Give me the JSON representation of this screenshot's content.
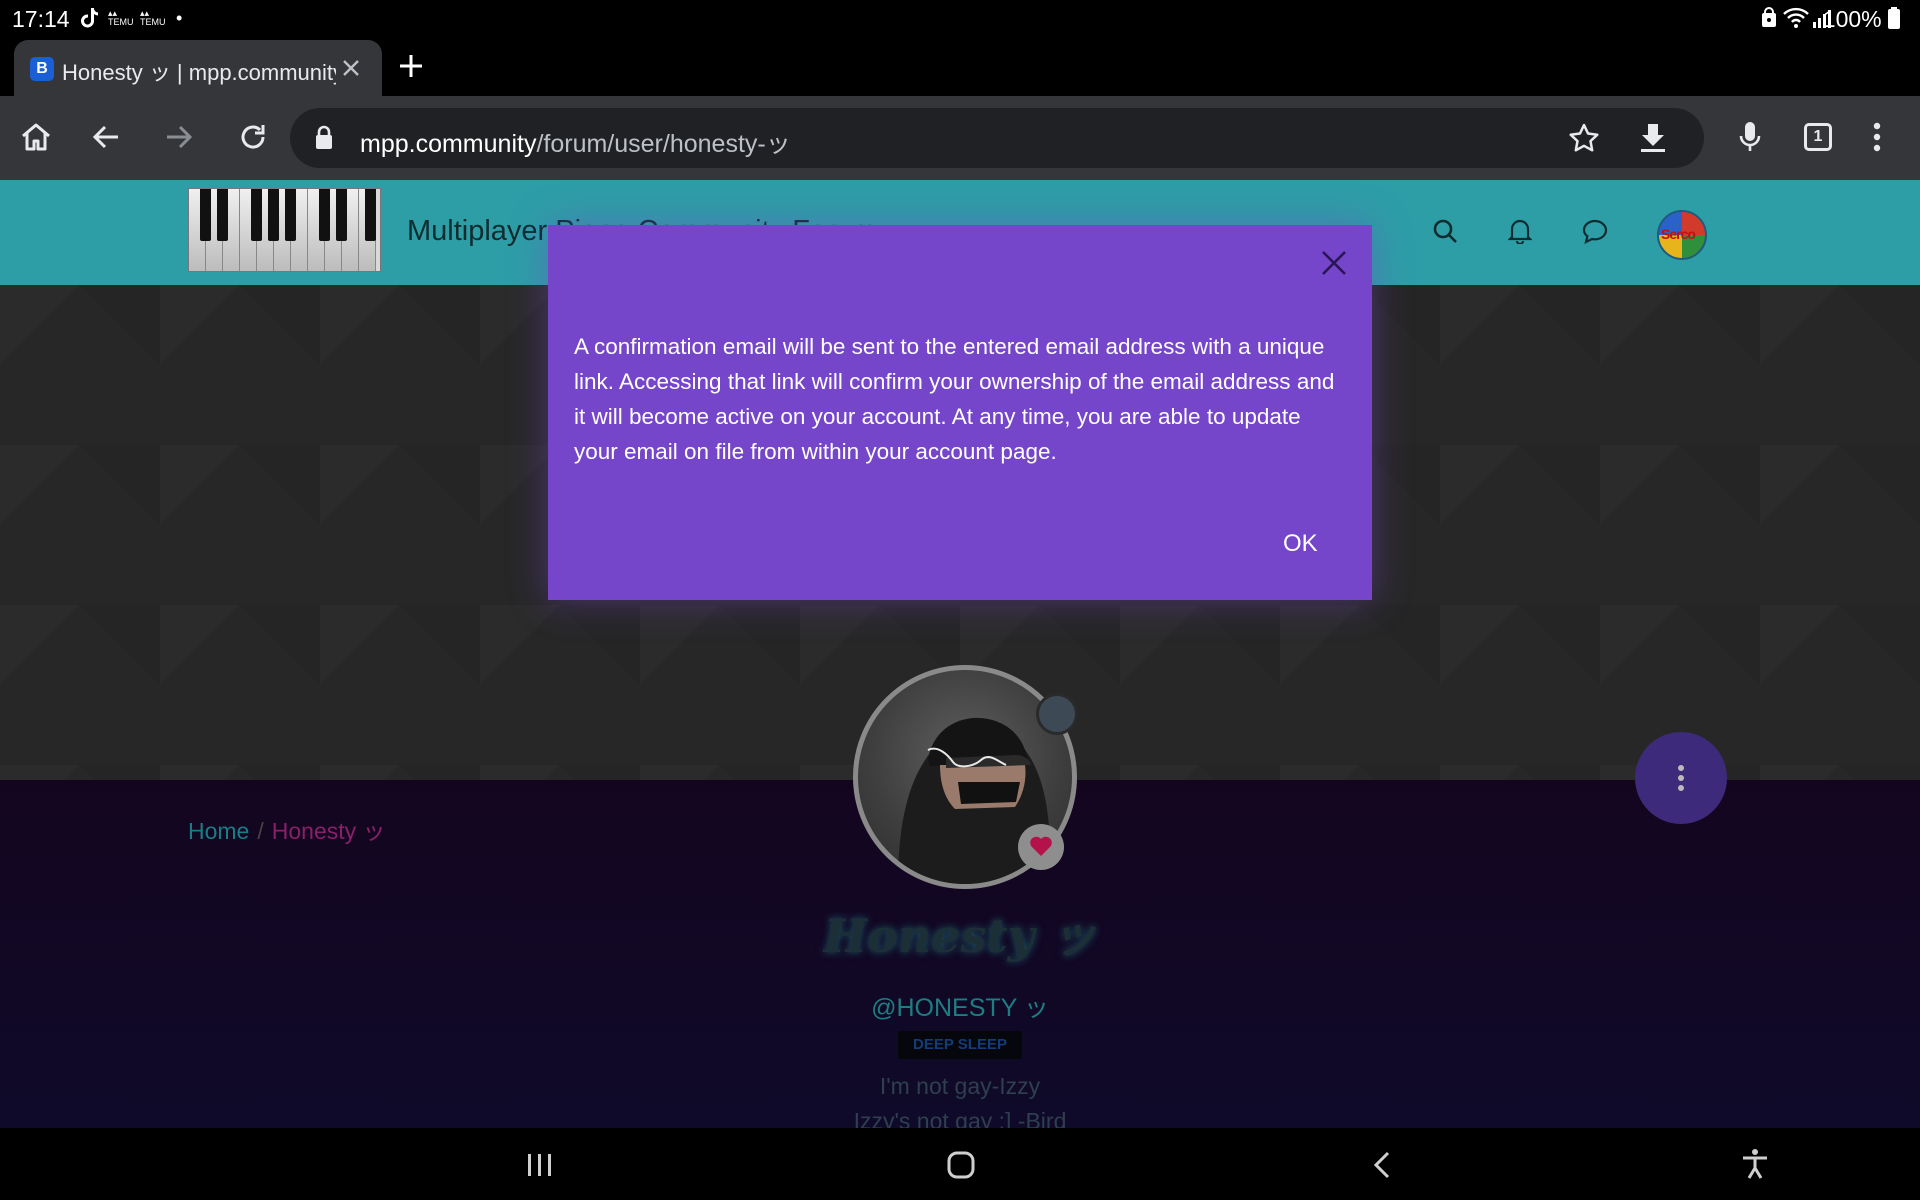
{
  "status_bar": {
    "time": "17:14",
    "battery": "100%",
    "notification_icons": [
      "tiktok-icon",
      "temu-icon",
      "temu-icon",
      "dot-icon"
    ]
  },
  "browser": {
    "tab": {
      "favicon_letter": "B",
      "title": "Honesty ッ | mpp.community"
    },
    "url_host": "mpp.community",
    "url_path": "/forum/user/honesty-ッ",
    "tab_count": "1"
  },
  "site": {
    "title": "Multiplayer Piano Community Forum",
    "avatar_text": "Serco",
    "accent_color": "#2d9ea6"
  },
  "breadcrumb": {
    "home": "Home",
    "separator": "/",
    "current": "Honesty ッ"
  },
  "profile": {
    "display_name": "Honesty ッ",
    "handle": "@HONESTY ッ",
    "badge": "DEEP SLEEP",
    "bio_line1": "I'm not gay-Izzy",
    "bio_line2": "Izzy's not gay :] -Bird"
  },
  "modal": {
    "message": "A confirmation email will be sent to the entered email address with a unique link. Accessing that link will confirm your ownership of the email address and it will become active on your account. At any time, you are able to update your email on file from within your account page.",
    "ok_label": "OK",
    "background": "#7546c9"
  }
}
